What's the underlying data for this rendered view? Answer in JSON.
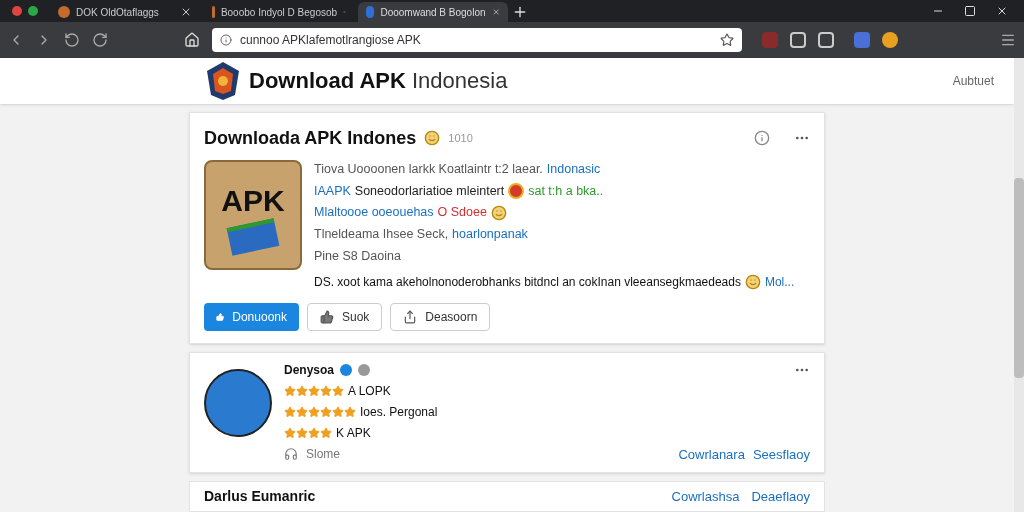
{
  "browser": {
    "tabs": [
      {
        "title": "DOK OldOtaflaggs",
        "selected": false
      },
      {
        "title": "Booobo Indyol D Begosob",
        "selected": false
      },
      {
        "title": "Dooomwand B Bogolon",
        "selected": true
      }
    ],
    "address": "cunnoo APKlafemotlrangiose APK"
  },
  "site": {
    "title_bold": "Download APK",
    "title_light": "Indonesia",
    "nav_link": "Aubtuet"
  },
  "post": {
    "title": "Downloada APK Indones",
    "meta": "1010",
    "image_label": "APK",
    "lines": [
      [
        {
          "text": "Tiova Uoooonen larkk Koatlaintr t:2 laear.",
          "kind": "muted"
        },
        {
          "text": "Indonasic",
          "kind": "link"
        }
      ],
      [
        {
          "text": "IAAPK",
          "kind": "link"
        },
        {
          "text": "Soneodorlariatioe mleintert",
          "kind": "dark"
        },
        {
          "kind": "alert"
        },
        {
          "text": "sat t:h a bka..",
          "kind": "green"
        }
      ],
      [
        {
          "text": "Mlaltoooe ooeouehas",
          "kind": "link"
        },
        {
          "text": "O Sdoee",
          "kind": "red"
        },
        {
          "kind": "emoji"
        }
      ],
      [
        {
          "text": "Tlneldeama Ihsee Seck,",
          "kind": "muted"
        },
        {
          "text": "hoarlonpanak",
          "kind": "link"
        }
      ],
      [
        {
          "text": "Pine S8 Daoina",
          "kind": "muted"
        }
      ]
    ],
    "summary": "DS. xoot kama akeholnonoderobhanks bitdncl an cokInan vleeansegkmaedeads",
    "more": "Mol...",
    "buttons": [
      {
        "label": "Donuoonk",
        "kind": "primary"
      },
      {
        "label": "Suok",
        "kind": "like"
      },
      {
        "label": "Deasoorn",
        "kind": "share"
      }
    ]
  },
  "review": {
    "name": "Denysoa",
    "ratings": [
      {
        "stars": 5,
        "text": "A LOPK"
      },
      {
        "stars": 6,
        "text": "Ioes. Pergonal"
      },
      {
        "stars": 4,
        "text": "K APK"
      }
    ],
    "footer": "Slome",
    "link_1": "Cowrlanara",
    "link_2": "Seesflaoy"
  },
  "next_card": {
    "title": "Darlus Eumanric",
    "link_1": "Cowrlashsa",
    "link_2": "Deaeflaoy"
  }
}
